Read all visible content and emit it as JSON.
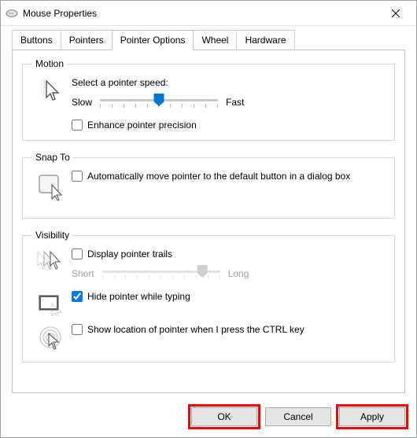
{
  "window": {
    "title": "Mouse Properties"
  },
  "tabs": [
    {
      "label": "Buttons"
    },
    {
      "label": "Pointers"
    },
    {
      "label": "Pointer Options"
    },
    {
      "label": "Wheel"
    },
    {
      "label": "Hardware"
    }
  ],
  "motion": {
    "legend": "Motion",
    "label": "Select a pointer speed:",
    "slow": "Slow",
    "fast": "Fast",
    "speed_position_pct": 50,
    "enhance_label": "Enhance pointer precision",
    "enhance_checked": false
  },
  "snapto": {
    "legend": "Snap To",
    "auto_label": "Automatically move pointer to the default button in a dialog box",
    "auto_checked": false
  },
  "visibility": {
    "legend": "Visibility",
    "trails_label": "Display pointer trails",
    "trails_checked": false,
    "short": "Short",
    "long": "Long",
    "trail_position_pct": 85,
    "hide_label": "Hide pointer while typing",
    "hide_checked": true,
    "ctrl_label": "Show location of pointer when I press the CTRL key",
    "ctrl_checked": false
  },
  "buttons": {
    "ok": "OK",
    "cancel": "Cancel",
    "apply": "Apply"
  }
}
